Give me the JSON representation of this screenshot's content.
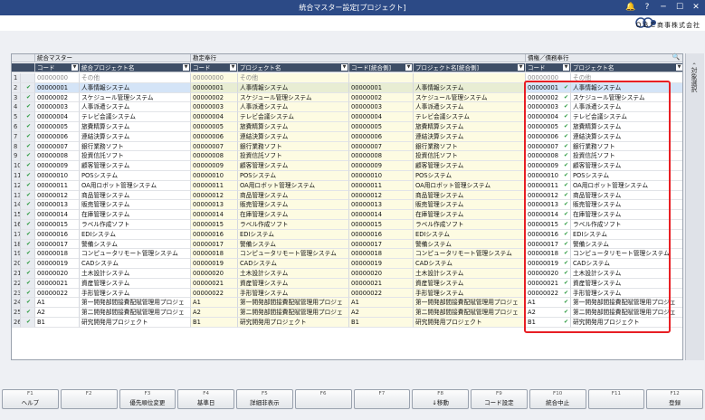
{
  "window": {
    "title": "統合マスター設定[プロジェクト]",
    "icons": [
      "bell-icon",
      "help-icon",
      "minimize-icon",
      "maximize-icon",
      "close-icon"
    ]
  },
  "company": "ＯＢＣ商事株式会社",
  "groups": [
    "統合マスター",
    "勘定奉行",
    "債権／債務奉行"
  ],
  "columns": [
    "コード",
    "統合プロジェクト名",
    "コード",
    "プロジェクト名",
    "コード[統合側]",
    "プロジェクト名[統合側]",
    "コード",
    "プロジェクト名"
  ],
  "side_tab": "対象選択",
  "rows": [
    [
      "1",
      "00000000",
      "その他",
      "00000000",
      "その他",
      "",
      "",
      "00000000",
      "その他"
    ],
    [
      "2",
      "00000001",
      "人事情報システム",
      "00000001",
      "人事情報システム",
      "00000001",
      "人事情報システム",
      "00000001",
      "人事情報システム"
    ],
    [
      "3",
      "00000002",
      "スケジュール管理システム",
      "00000002",
      "スケジュール管理システム",
      "00000002",
      "スケジュール管理システム",
      "00000002",
      "スケジュール管理システム"
    ],
    [
      "4",
      "00000003",
      "人事派遣システム",
      "00000003",
      "人事派遣システム",
      "00000003",
      "人事派遣システム",
      "00000003",
      "人事派遣システム"
    ],
    [
      "5",
      "00000004",
      "テレビ会議システム",
      "00000004",
      "テレビ会議システム",
      "00000004",
      "テレビ会議システム",
      "00000004",
      "テレビ会議システム"
    ],
    [
      "6",
      "00000005",
      "旅費精算システム",
      "00000005",
      "旅費精算システム",
      "00000005",
      "旅費精算システム",
      "00000005",
      "旅費精算システム"
    ],
    [
      "7",
      "00000006",
      "連結決算システム",
      "00000006",
      "連結決算システム",
      "00000006",
      "連結決算システム",
      "00000006",
      "連結決算システム"
    ],
    [
      "8",
      "00000007",
      "銀行業務ソフト",
      "00000007",
      "銀行業務ソフト",
      "00000007",
      "銀行業務ソフト",
      "00000007",
      "銀行業務ソフト"
    ],
    [
      "9",
      "00000008",
      "投資信託ソフト",
      "00000008",
      "投資信託ソフト",
      "00000008",
      "投資信託ソフト",
      "00000008",
      "投資信託ソフト"
    ],
    [
      "10",
      "00000009",
      "顧客管理システム",
      "00000009",
      "顧客管理システム",
      "00000009",
      "顧客管理システム",
      "00000009",
      "顧客管理システム"
    ],
    [
      "11",
      "00000010",
      "POSシステム",
      "00000010",
      "POSシステム",
      "00000010",
      "POSシステム",
      "00000010",
      "POSシステム"
    ],
    [
      "12",
      "00000011",
      "OA用ロボット管理システム",
      "00000011",
      "OA用ロボット管理システム",
      "00000011",
      "OA用ロボット管理システム",
      "00000011",
      "OA用ロボット管理システム"
    ],
    [
      "13",
      "00000012",
      "商品管理システム",
      "00000012",
      "商品管理システム",
      "00000012",
      "商品管理システム",
      "00000012",
      "商品管理システム"
    ],
    [
      "14",
      "00000013",
      "販売管理システム",
      "00000013",
      "販売管理システム",
      "00000013",
      "販売管理システム",
      "00000013",
      "販売管理システム"
    ],
    [
      "15",
      "00000014",
      "在庫管理システム",
      "00000014",
      "在庫管理システム",
      "00000014",
      "在庫管理システム",
      "00000014",
      "在庫管理システム"
    ],
    [
      "16",
      "00000015",
      "ラベル作成ソフト",
      "00000015",
      "ラベル作成ソフト",
      "00000015",
      "ラベル作成ソフト",
      "00000015",
      "ラベル作成ソフト"
    ],
    [
      "17",
      "00000016",
      "EDIシステム",
      "00000016",
      "EDIシステム",
      "00000016",
      "EDIシステム",
      "00000016",
      "EDIシステム"
    ],
    [
      "18",
      "00000017",
      "警備システム",
      "00000017",
      "警備システム",
      "00000017",
      "警備システム",
      "00000017",
      "警備システム"
    ],
    [
      "19",
      "00000018",
      "コンピュータリモート管理システム",
      "00000018",
      "コンピュータリモート管理システム",
      "00000018",
      "コンピュータリモート管理システム",
      "00000018",
      "コンピュータリモート管理システム"
    ],
    [
      "20",
      "00000019",
      "CADシステム",
      "00000019",
      "CADシステム",
      "00000019",
      "CADシステム",
      "00000019",
      "CADシステム"
    ],
    [
      "21",
      "00000020",
      "土木設計システム",
      "00000020",
      "土木設計システム",
      "00000020",
      "土木設計システム",
      "00000020",
      "土木設計システム"
    ],
    [
      "22",
      "00000021",
      "資産管理システム",
      "00000021",
      "資産管理システム",
      "00000021",
      "資産管理システム",
      "00000021",
      "資産管理システム"
    ],
    [
      "23",
      "00000022",
      "手形管理システム",
      "00000022",
      "手形管理システム",
      "00000022",
      "手形管理システム",
      "00000022",
      "手形管理システム"
    ],
    [
      "24",
      "A1",
      "第一開発部間接費配賦管理用プロジェ",
      "A1",
      "第一開発部間接費配賦管理用プロジェ",
      "A1",
      "第一開発部間接費配賦管理用プロジェ",
      "A1",
      "第一開発部間接費配賦管理用プロジェ"
    ],
    [
      "25",
      "A2",
      "第二開発部間接費配賦管理用プロジェ",
      "A2",
      "第二開発部間接費配賦管理用プロジェ",
      "A2",
      "第二開発部間接費配賦管理用プロジェ",
      "A2",
      "第二開発部間接費配賦管理用プロジェ"
    ],
    [
      "26",
      "B1",
      "研究開発用プロジェクト",
      "B1",
      "研究開発用プロジェクト",
      "B1",
      "研究開発用プロジェクト",
      "B1",
      "研究開発用プロジェクト"
    ]
  ],
  "fkeys": [
    {
      "key": "F1",
      "label": "ヘルプ"
    },
    {
      "key": "F2",
      "label": ""
    },
    {
      "key": "F3",
      "label": "優先順位変更"
    },
    {
      "key": "F4",
      "label": "基準日"
    },
    {
      "key": "F5",
      "label": "詳細非表示"
    },
    {
      "key": "F6",
      "label": ""
    },
    {
      "key": "F7",
      "label": ""
    },
    {
      "key": "F8",
      "label": "↓移動"
    },
    {
      "key": "F9",
      "label": "コード設定"
    },
    {
      "key": "F10",
      "label": "統合中止"
    },
    {
      "key": "F11",
      "label": ""
    },
    {
      "key": "F12",
      "label": "登録"
    }
  ]
}
